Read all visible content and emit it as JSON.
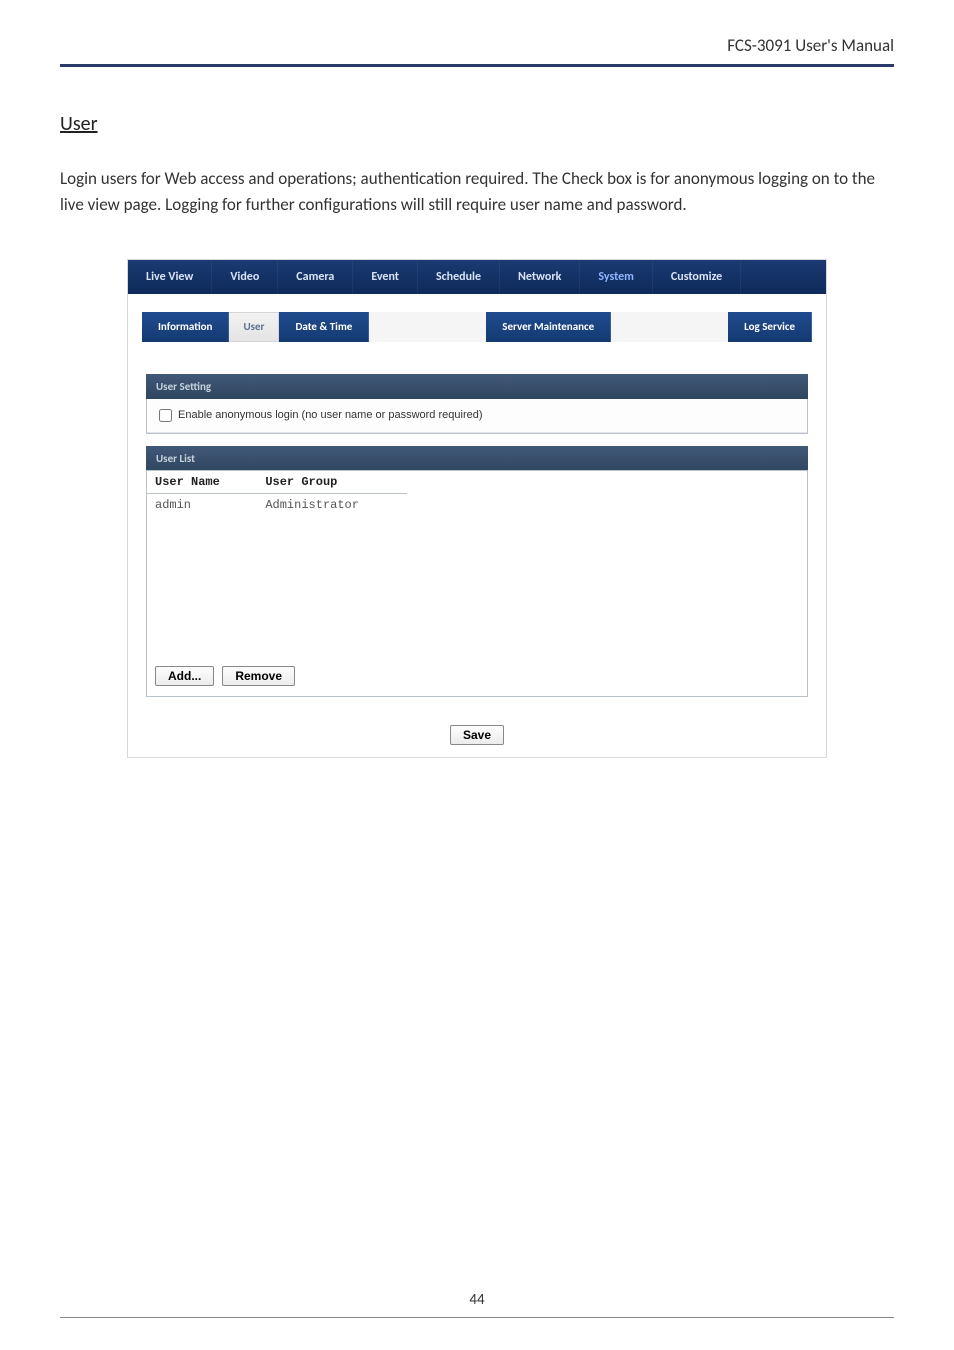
{
  "header": {
    "running": "FCS-3091 User's Manual"
  },
  "section": {
    "title": "User",
    "paragraph": "Login users for Web access and operations; authentication required. The Check box is for anonymous logging on to the live view page. Logging for further configurations will still require user name and password."
  },
  "topnav": {
    "items": [
      "Live View",
      "Video",
      "Camera",
      "Event",
      "Schedule",
      "Network",
      "System",
      "Customize"
    ],
    "selected_index": 6
  },
  "subnav": {
    "items": [
      "Information",
      "User",
      "Date & Time",
      "Server Maintenance",
      "Log Service"
    ],
    "selected_index": 1
  },
  "panel": {
    "user_setting_title": "User Setting",
    "anonymous_label": "Enable anonymous login (no user name or password required)",
    "anonymous_checked": false,
    "user_list_title": "User List",
    "columns": [
      "User Name",
      "User Group"
    ],
    "rows": [
      {
        "name": "admin",
        "group": "Administrator"
      }
    ],
    "add_label": "Add...",
    "remove_label": "Remove",
    "save_label": "Save"
  },
  "footer": {
    "page_number": "44"
  }
}
